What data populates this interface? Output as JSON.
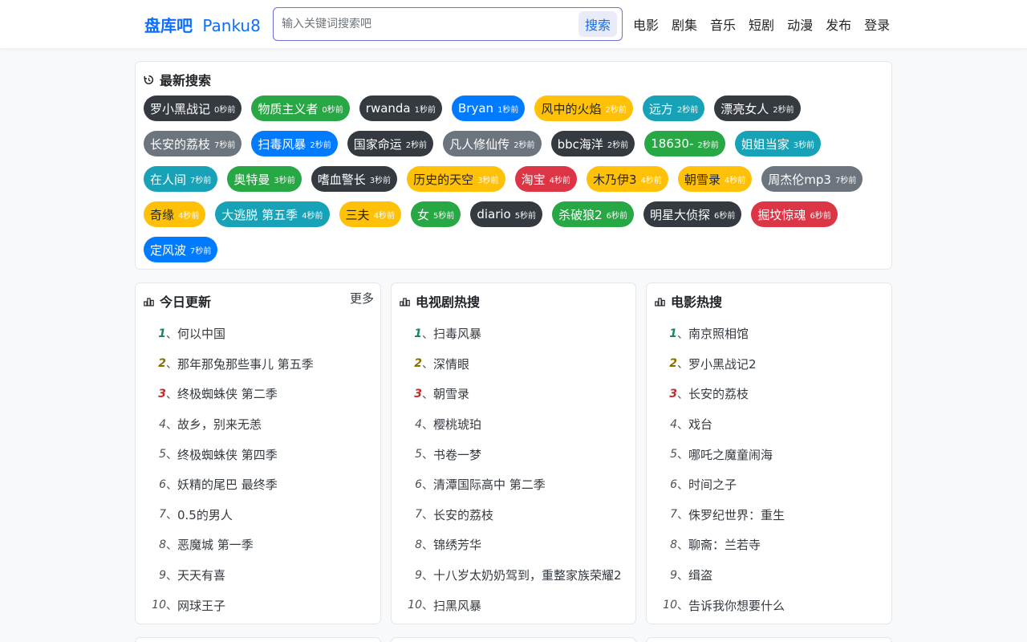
{
  "site": {
    "name": "盘库吧",
    "domain": "Panku8"
  },
  "search": {
    "placeholder": "输入关键词搜索吧",
    "button": "搜索"
  },
  "nav": [
    "电影",
    "剧集",
    "音乐",
    "短剧",
    "动漫",
    "发布",
    "登录"
  ],
  "recent": {
    "title": "最新搜索",
    "icon": "history-icon",
    "rows": [
      [
        {
          "name": "罗小黑战记",
          "ago": "0秒前",
          "color": "#343a40"
        },
        {
          "name": "物质主义者",
          "ago": "0秒前",
          "color": "#28a745"
        },
        {
          "name": "rwanda",
          "ago": "1秒前",
          "color": "#343a40"
        },
        {
          "name": "Bryan",
          "ago": "1秒前",
          "color": "#007bff"
        },
        {
          "name": "风中的火焰",
          "ago": "2秒前",
          "color": "#ffc107"
        },
        {
          "name": "远方",
          "ago": "2秒前",
          "color": "#17a2b8"
        },
        {
          "name": "漂亮女人",
          "ago": "2秒前",
          "color": "#343a40"
        }
      ],
      [
        {
          "name": "长安的荔枝",
          "ago": "7秒前",
          "color": "#6c757d"
        },
        {
          "name": "扫毒风暴",
          "ago": "2秒前",
          "color": "#007bff"
        },
        {
          "name": "国家命运",
          "ago": "2秒前",
          "color": "#343a40"
        },
        {
          "name": "凡人修仙传",
          "ago": "2秒前",
          "color": "#6c757d"
        },
        {
          "name": "bbc海洋",
          "ago": "2秒前",
          "color": "#343a40"
        },
        {
          "name": "18630-",
          "ago": "2秒前",
          "color": "#28a745"
        },
        {
          "name": "姐姐当家",
          "ago": "3秒前",
          "color": "#17a2b8"
        }
      ],
      [
        {
          "name": "在人间",
          "ago": "7秒前",
          "color": "#17a2b8"
        },
        {
          "name": "奥特曼",
          "ago": "3秒前",
          "color": "#28a745"
        },
        {
          "name": "嗜血警长",
          "ago": "3秒前",
          "color": "#343a40"
        },
        {
          "name": "历史的天空",
          "ago": "3秒前",
          "color": "#ffc107"
        },
        {
          "name": "淘宝",
          "ago": "4秒前",
          "color": "#dc3545"
        },
        {
          "name": "木乃伊3",
          "ago": "4秒前",
          "color": "#ffc107"
        },
        {
          "name": "朝雪录",
          "ago": "4秒前",
          "color": "#ffc107"
        },
        {
          "name": "周杰伦mp3",
          "ago": "7秒前",
          "color": "#6c757d"
        }
      ],
      [
        {
          "name": "奇缘",
          "ago": "4秒前",
          "color": "#ffc107"
        },
        {
          "name": "大逃脱 第五季",
          "ago": "4秒前",
          "color": "#17a2b8"
        },
        {
          "name": "三夫",
          "ago": "4秒前",
          "color": "#ffc107"
        },
        {
          "name": "女",
          "ago": "5秒前",
          "color": "#28a745"
        },
        {
          "name": "diario",
          "ago": "5秒前",
          "color": "#343a40"
        },
        {
          "name": "杀破狼2",
          "ago": "6秒前",
          "color": "#28a745"
        },
        {
          "name": "明星大侦探",
          "ago": "6秒前",
          "color": "#343a40"
        },
        {
          "name": "掘坟惊魂",
          "ago": "6秒前",
          "color": "#dc3545"
        }
      ],
      [
        {
          "name": "定风波",
          "ago": "7秒前",
          "color": "#007bff"
        }
      ]
    ]
  },
  "today": {
    "title": "今日更新",
    "more": "更多",
    "items": [
      "何以中国",
      "那年那兔那些事儿 第五季",
      "终极蜘蛛侠 第二季",
      "故乡，别来无恙",
      "终极蜘蛛侠 第四季",
      "妖精的尾巴 最终季",
      "0.5的男人",
      "恶魔城 第一季",
      "天天有喜",
      "网球王子"
    ]
  },
  "tv": {
    "title": "电视剧热搜",
    "items": [
      "扫毒风暴",
      "深情眼",
      "朝雪录",
      "樱桃琥珀",
      "书卷一梦",
      "清潭国际高中 第二季",
      "长安的荔枝",
      "锦绣芳华",
      "十八岁太奶奶驾到，重整家族荣耀2",
      "扫黑风暴"
    ]
  },
  "movie": {
    "title": "电影热搜",
    "items": [
      "南京照相馆",
      "罗小黑战记2",
      "长安的荔枝",
      "戏台",
      "哪吒之魔童闹海",
      "时间之子",
      "侏罗纪世界：重生",
      "聊斋：兰若寺",
      "缉盗",
      "告诉我你想要什么"
    ]
  }
}
